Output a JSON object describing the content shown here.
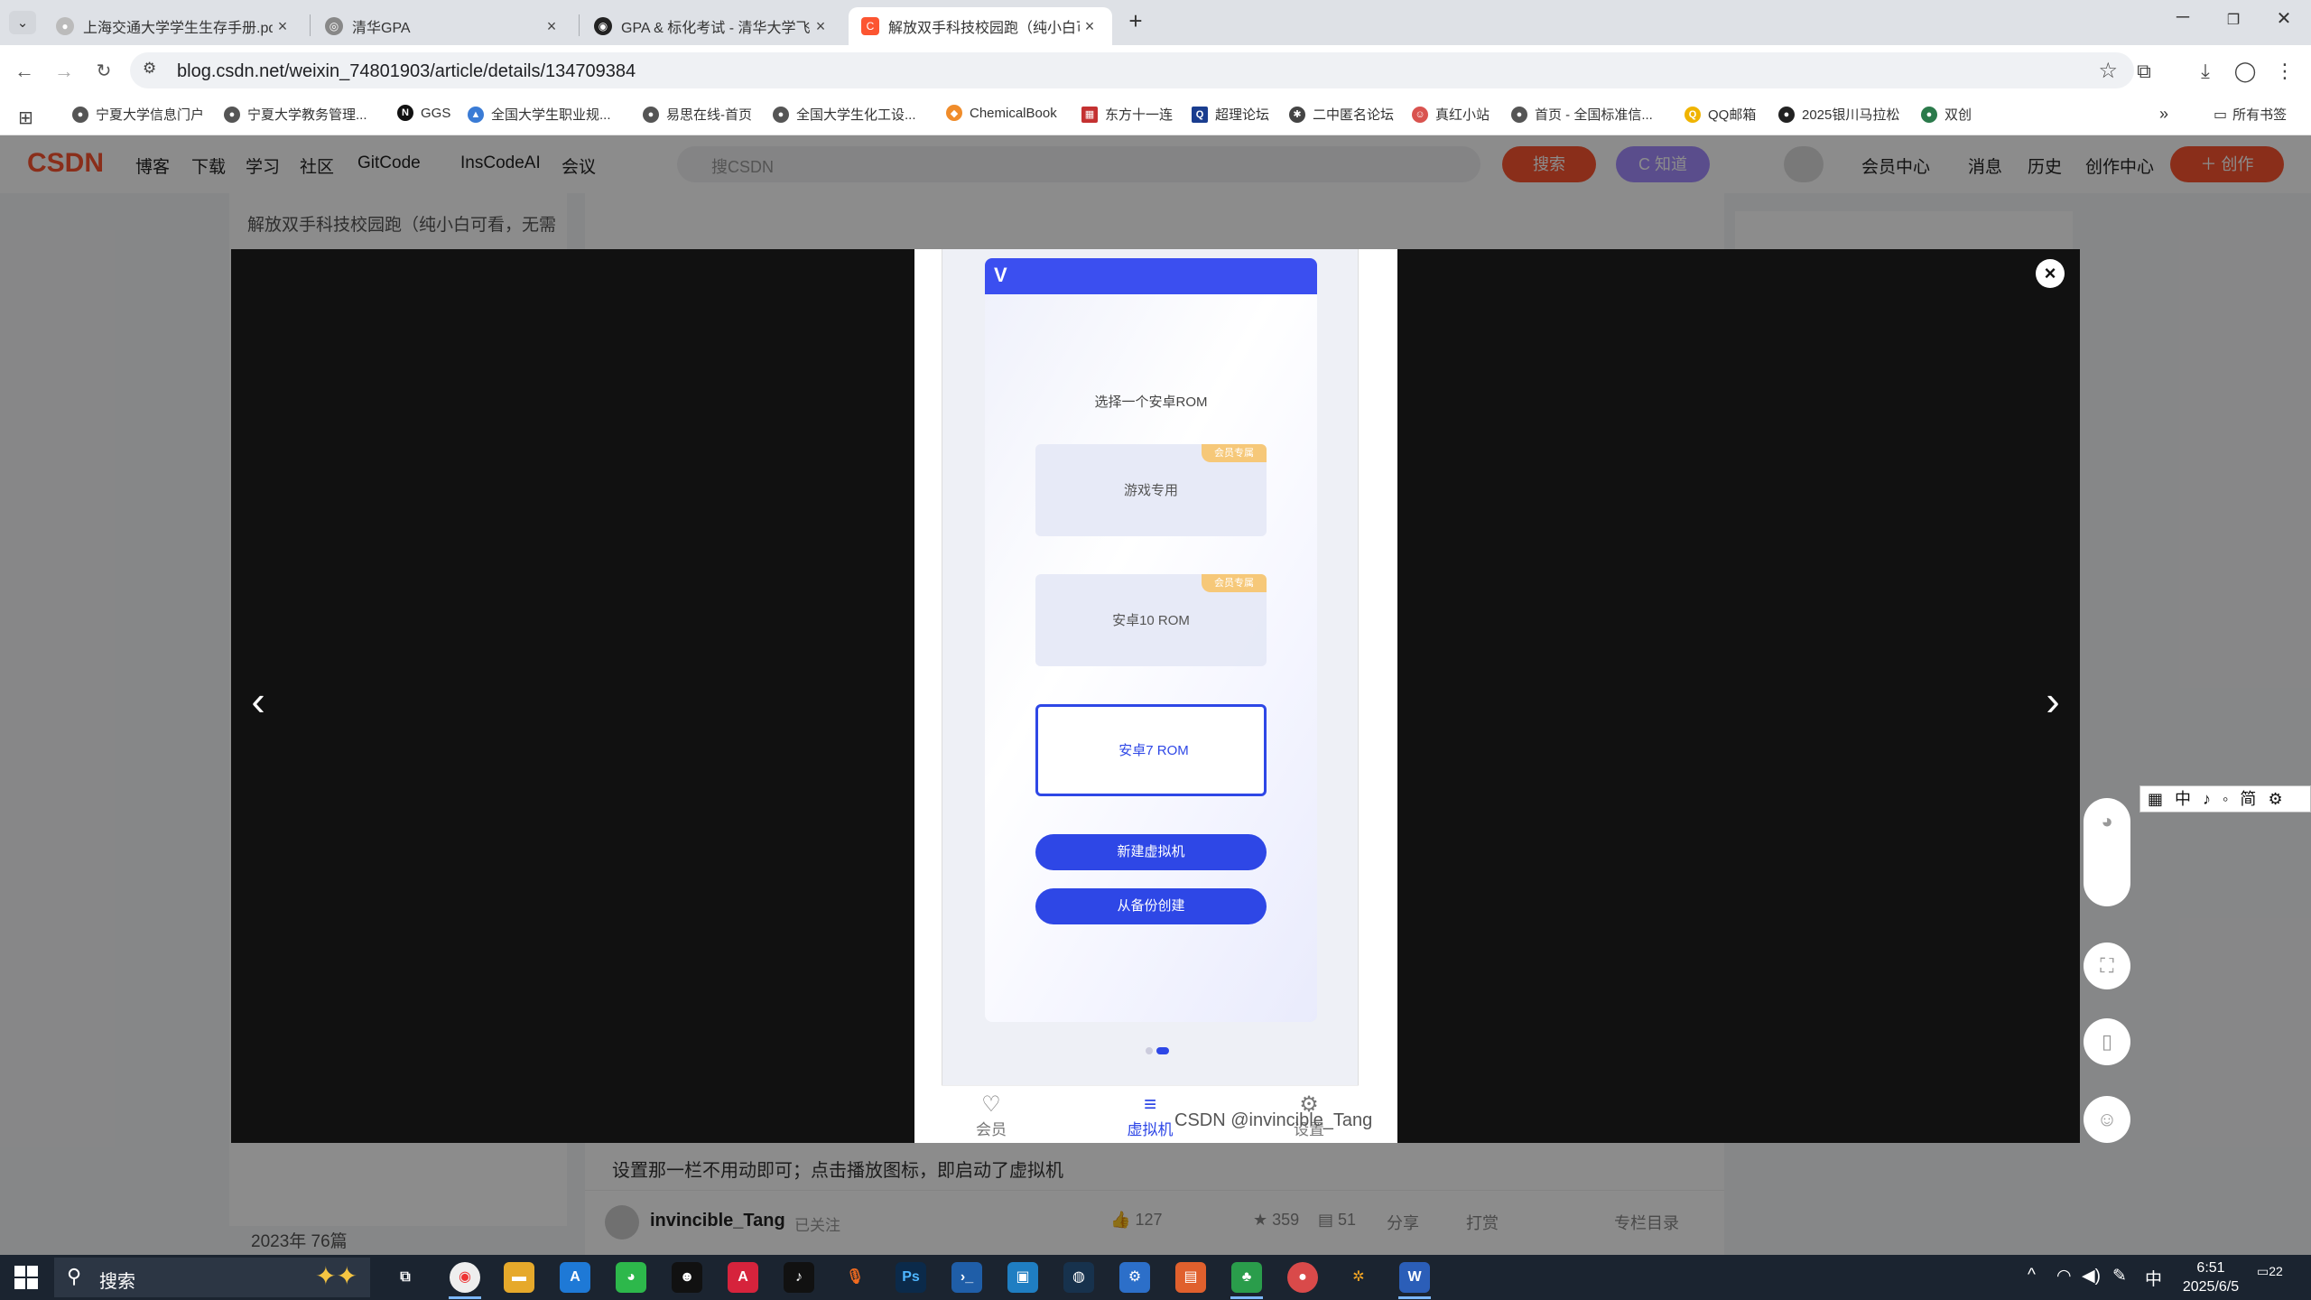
{
  "browser": {
    "tabs": [
      {
        "title": "上海交通大学学生生存手册.pdf",
        "active": false
      },
      {
        "title": "清华GPA",
        "active": false
      },
      {
        "title": "GPA & 标化考试 - 清华大学飞",
        "active": false
      },
      {
        "title": "解放双手科技校园跑（纯小白可",
        "active": true
      }
    ],
    "url": "blog.csdn.net/weixin_74801903/article/details/134709384",
    "bookmarks": [
      "宁夏大学信息门户",
      "宁夏大学教务管理...",
      "GGS",
      "全国大学生职业规...",
      "易思在线-首页",
      "全国大学生化工设...",
      "ChemicalBook",
      "东方十一连",
      "超理论坛",
      "二中匿名论坛",
      "真红小站",
      "首页 - 全国标准信...",
      "QQ邮箱",
      "2025银川马拉松",
      "双创"
    ],
    "all_bookmarks": "所有书签"
  },
  "csdn": {
    "logo": "CSDN",
    "nav": [
      "博客",
      "下载",
      "学习",
      "社区",
      "GitCode",
      "InsCodeAI",
      "会议"
    ],
    "search_placeholder": "搜CSDN",
    "search_button": "搜索",
    "zhidao_button": "C 知道",
    "right_nav": [
      "会员中心",
      "消息",
      "历史",
      "创作中心"
    ],
    "create_button": "＋ 创作",
    "sidebar": {
      "line1": "解放双手科技校园跑（纯小白可看，无需",
      "archive1": "2023年 76篇"
    },
    "article_text": "设置那一栏不用动即可；点击播放图标，即启动了虚拟机",
    "author": "invincible_Tang",
    "follow_status": "已关注",
    "likes": "127",
    "stars": "359",
    "comments": "51",
    "share": "分享",
    "print": "打赏",
    "column_toc": "专栏目录"
  },
  "viewer": {
    "app": {
      "prompt": "选择一个安卓ROM",
      "roms": [
        {
          "label": "游戏专用",
          "badge": "会员专属",
          "selected": false
        },
        {
          "label": "安卓10 ROM",
          "badge": "会员专属",
          "selected": false
        },
        {
          "label": "安卓7 ROM",
          "badge": "",
          "selected": true
        }
      ],
      "new_vm_button": "新建虚拟机",
      "backup_button": "从备份创建",
      "nav": [
        {
          "label": "会员",
          "icon": "diamond-icon",
          "active": false
        },
        {
          "label": "虚拟机",
          "icon": "server-icon",
          "active": true
        },
        {
          "label": "设置",
          "icon": "settings-icon",
          "active": false
        }
      ]
    },
    "watermark": "CSDN @invincible_Tang"
  },
  "ime": {
    "toolbar": "中 ♪ ◦ 简"
  },
  "taskbar": {
    "search_placeholder": "搜索",
    "tray_lang": "中",
    "time": "6:51",
    "date": "2025/6/5",
    "notifications": "22"
  }
}
